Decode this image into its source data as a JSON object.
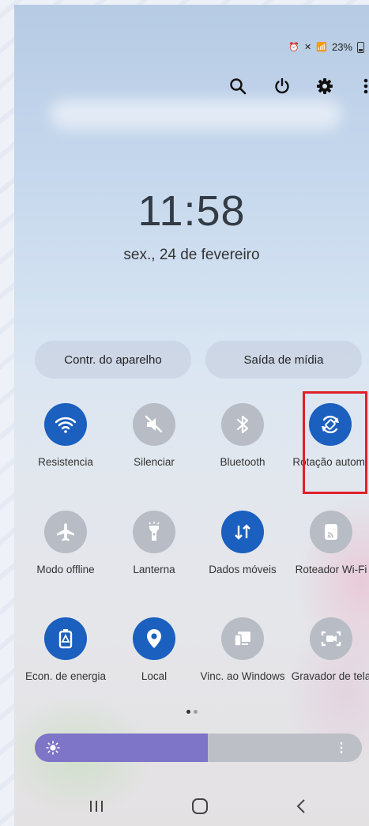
{
  "status_bar": {
    "battery": "23%"
  },
  "top_actions": [
    {
      "name": "search-icon"
    },
    {
      "name": "power-icon"
    },
    {
      "name": "settings-icon"
    },
    {
      "name": "more-icon"
    }
  ],
  "clock": {
    "time": "11:58",
    "date": "sex., 24 de fevereiro"
  },
  "buttons": {
    "device_control": "Contr. do aparelho",
    "media_output": "Saída de mídia"
  },
  "tiles": [
    {
      "label": "Resistencia",
      "state": "on"
    },
    {
      "label": "Silenciar",
      "state": "off"
    },
    {
      "label": "Bluetooth",
      "state": "off"
    },
    {
      "label": "Rotação autom.",
      "state": "on"
    },
    {
      "label": "Modo offline",
      "state": "off"
    },
    {
      "label": "Lanterna",
      "state": "off"
    },
    {
      "label": "Dados móveis",
      "state": "on"
    },
    {
      "label": "Roteador Wi-Fi",
      "state": "off"
    },
    {
      "label": "Econ. de energia",
      "state": "on"
    },
    {
      "label": "Local",
      "state": "on"
    },
    {
      "label": "Vinc. ao Windows",
      "state": "off"
    },
    {
      "label": "Gravador de tela",
      "state": "off"
    }
  ],
  "brightness": {
    "level": 0.53
  },
  "colors": {
    "accent": "#1b5fbf",
    "tile_off": "#b7bcc5",
    "brightness_fill": "#7e74c8",
    "highlight": "#e0202b"
  }
}
